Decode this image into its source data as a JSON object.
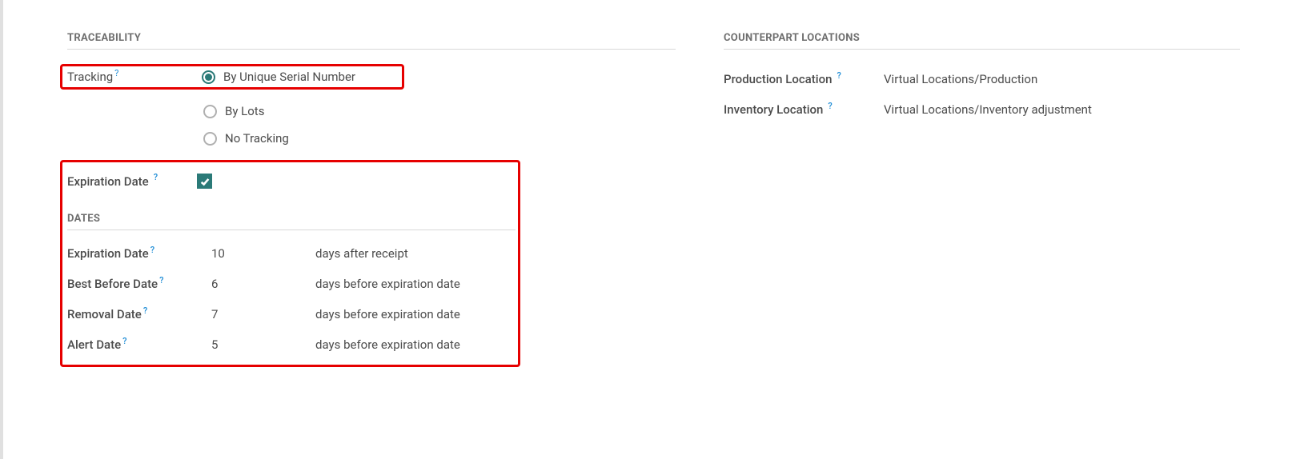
{
  "traceability": {
    "header": "Traceability",
    "tracking_label": "Tracking",
    "tracking_options": {
      "serial": "By Unique Serial Number",
      "lots": "By Lots",
      "none": "No Tracking"
    },
    "expiration_date_label": "Expiration Date"
  },
  "dates": {
    "header": "Dates",
    "rows": {
      "expiration": {
        "label": "Expiration Date",
        "value": "10",
        "suffix": "days after receipt"
      },
      "best_before": {
        "label": "Best Before Date",
        "value": "6",
        "suffix": "days before expiration date"
      },
      "removal": {
        "label": "Removal Date",
        "value": "7",
        "suffix": "days before expiration date"
      },
      "alert": {
        "label": "Alert Date",
        "value": "5",
        "suffix": "days before expiration date"
      }
    }
  },
  "counterpart": {
    "header": "Counterpart Locations",
    "production_label": "Production Location",
    "production_value": "Virtual Locations/Production",
    "inventory_label": "Inventory Location",
    "inventory_value": "Virtual Locations/Inventory adjustment"
  },
  "help_glyph": "?"
}
